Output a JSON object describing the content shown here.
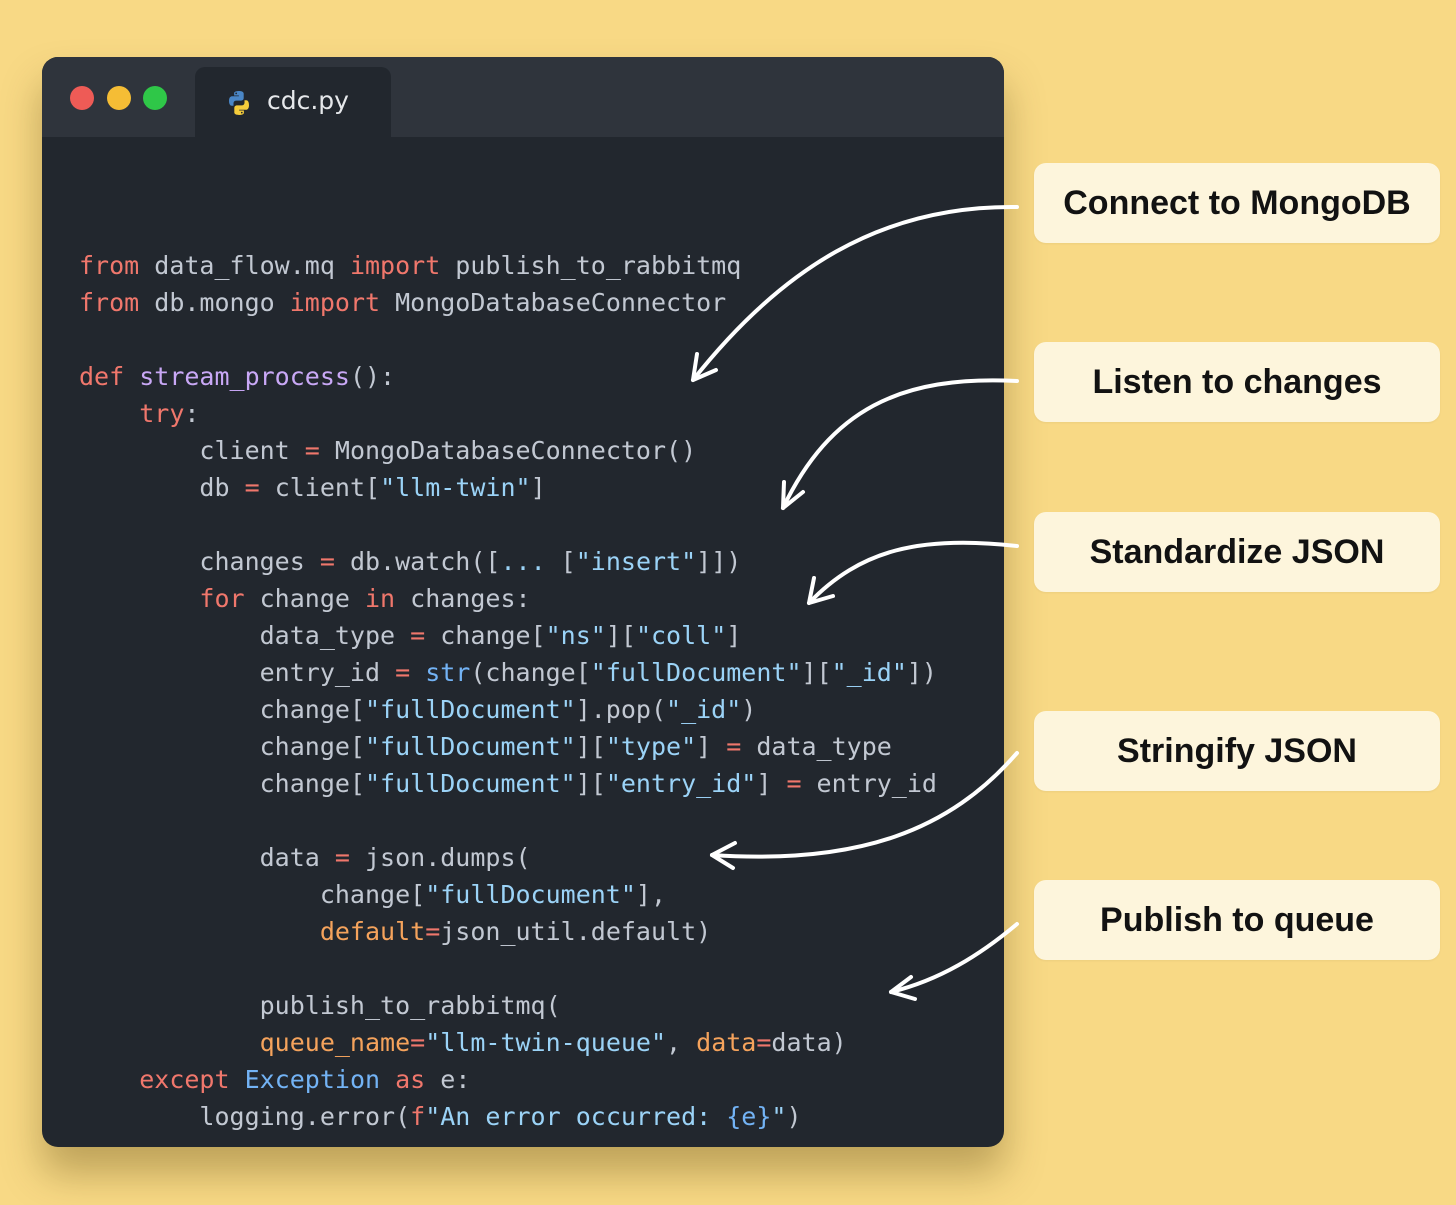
{
  "window": {
    "tab_title": "cdc.py",
    "tab_icon": "python-icon",
    "traffic_lights": {
      "close_color": "#ee5b56",
      "minimize_color": "#f5bd35",
      "maximize_color": "#2fc748"
    }
  },
  "colors": {
    "background": "#f8d985",
    "editor_background": "#22272e",
    "keyword": "#f0776c",
    "function": "#c9a8f6",
    "string": "#9bd3f7",
    "builtin": "#73b3f5",
    "param": "#f5a35c",
    "text": "#c2c8d2"
  },
  "code": [
    [],
    [
      [
        "kw",
        "from"
      ],
      [
        "plain",
        " data_flow.mq "
      ],
      [
        "kw",
        "import"
      ],
      [
        "plain",
        " publish_to_rabbitmq"
      ]
    ],
    [
      [
        "kw",
        "from"
      ],
      [
        "plain",
        " db.mongo "
      ],
      [
        "kw",
        "import"
      ],
      [
        "plain",
        " MongoDatabaseConnector"
      ]
    ],
    [],
    [
      [
        "kw",
        "def"
      ],
      [
        "plain",
        " "
      ],
      [
        "fn",
        "stream_process"
      ],
      [
        "plain",
        "():"
      ]
    ],
    [
      [
        "plain",
        "    "
      ],
      [
        "kw",
        "try"
      ],
      [
        "plain",
        ":"
      ]
    ],
    [
      [
        "plain",
        "        client "
      ],
      [
        "op",
        "="
      ],
      [
        "plain",
        " MongoDatabaseConnector()"
      ]
    ],
    [
      [
        "plain",
        "        db "
      ],
      [
        "op",
        "="
      ],
      [
        "plain",
        " client["
      ],
      [
        "str",
        "\"llm-twin\""
      ],
      [
        "plain",
        "]"
      ]
    ],
    [],
    [
      [
        "plain",
        "        changes "
      ],
      [
        "op",
        "="
      ],
      [
        "plain",
        " db.watch(["
      ],
      [
        "str",
        "..."
      ],
      [
        "plain",
        " ["
      ],
      [
        "str",
        "\"insert\""
      ],
      [
        "plain",
        "]])"
      ]
    ],
    [
      [
        "plain",
        "        "
      ],
      [
        "kw",
        "for"
      ],
      [
        "plain",
        " change "
      ],
      [
        "kw",
        "in"
      ],
      [
        "plain",
        " changes:"
      ]
    ],
    [
      [
        "plain",
        "            data_type "
      ],
      [
        "op",
        "="
      ],
      [
        "plain",
        " change["
      ],
      [
        "str",
        "\"ns\""
      ],
      [
        "plain",
        "]["
      ],
      [
        "str",
        "\"coll\""
      ],
      [
        "plain",
        "]"
      ]
    ],
    [
      [
        "plain",
        "            entry_id "
      ],
      [
        "op",
        "="
      ],
      [
        "plain",
        " "
      ],
      [
        "builtin",
        "str"
      ],
      [
        "plain",
        "(change["
      ],
      [
        "str",
        "\"fullDocument\""
      ],
      [
        "plain",
        "]["
      ],
      [
        "str",
        "\"_id\""
      ],
      [
        "plain",
        "])"
      ]
    ],
    [
      [
        "plain",
        "            change["
      ],
      [
        "str",
        "\"fullDocument\""
      ],
      [
        "plain",
        "].pop("
      ],
      [
        "str",
        "\"_id\""
      ],
      [
        "plain",
        ")"
      ]
    ],
    [
      [
        "plain",
        "            change["
      ],
      [
        "str",
        "\"fullDocument\""
      ],
      [
        "plain",
        "]["
      ],
      [
        "str",
        "\"type\""
      ],
      [
        "plain",
        "] "
      ],
      [
        "op",
        "="
      ],
      [
        "plain",
        " data_type"
      ]
    ],
    [
      [
        "plain",
        "            change["
      ],
      [
        "str",
        "\"fullDocument\""
      ],
      [
        "plain",
        "]["
      ],
      [
        "str",
        "\"entry_id\""
      ],
      [
        "plain",
        "] "
      ],
      [
        "op",
        "="
      ],
      [
        "plain",
        " entry_id"
      ]
    ],
    [],
    [
      [
        "plain",
        "            data "
      ],
      [
        "op",
        "="
      ],
      [
        "plain",
        " json.dumps("
      ]
    ],
    [
      [
        "plain",
        "                change["
      ],
      [
        "str",
        "\"fullDocument\""
      ],
      [
        "plain",
        "],"
      ]
    ],
    [
      [
        "plain",
        "                "
      ],
      [
        "param",
        "default"
      ],
      [
        "op",
        "="
      ],
      [
        "plain",
        "json_util.default)"
      ]
    ],
    [],
    [
      [
        "plain",
        "            publish_to_rabbitmq("
      ]
    ],
    [
      [
        "plain",
        "            "
      ],
      [
        "param",
        "queue_name"
      ],
      [
        "op",
        "="
      ],
      [
        "str",
        "\"llm-twin-queue\""
      ],
      [
        "plain",
        ", "
      ],
      [
        "param",
        "data"
      ],
      [
        "op",
        "="
      ],
      [
        "plain",
        "data)"
      ]
    ],
    [
      [
        "plain",
        "    "
      ],
      [
        "kw",
        "except"
      ],
      [
        "plain",
        " "
      ],
      [
        "builtin",
        "Exception"
      ],
      [
        "plain",
        " "
      ],
      [
        "kw",
        "as"
      ],
      [
        "plain",
        " e:"
      ]
    ],
    [
      [
        "plain",
        "        logging.error("
      ],
      [
        "kw",
        "f"
      ],
      [
        "str",
        "\"An error occurred: "
      ],
      [
        "builtin",
        "{e}"
      ],
      [
        "str",
        "\""
      ],
      [
        "plain",
        ")"
      ]
    ]
  ],
  "callouts": [
    {
      "label": "Connect to MongoDB"
    },
    {
      "label": "Listen to changes"
    },
    {
      "label": "Standardize JSON"
    },
    {
      "label": "Stringify JSON"
    },
    {
      "label": "Publish to queue"
    }
  ]
}
